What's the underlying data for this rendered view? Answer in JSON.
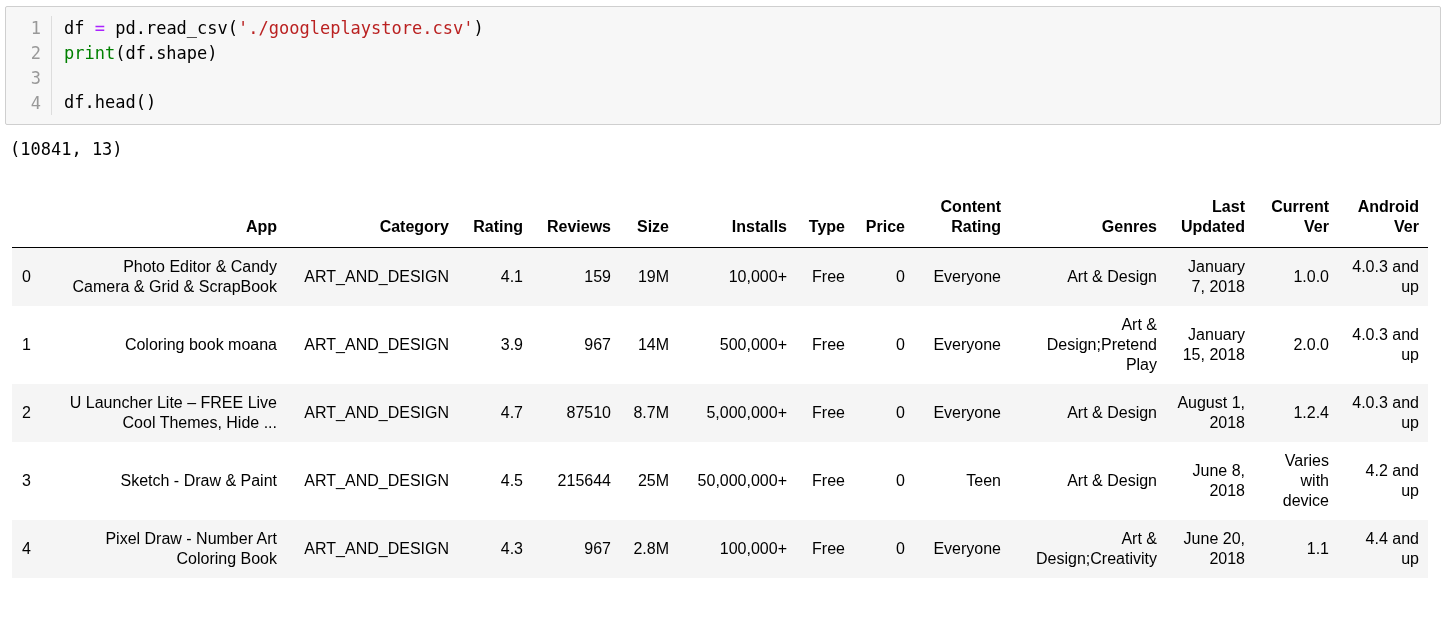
{
  "code_cell": {
    "lines": [
      {
        "number": "1",
        "tokens": [
          {
            "kind": "plain",
            "text": "df "
          },
          {
            "kind": "operator",
            "text": "="
          },
          {
            "kind": "plain",
            "text": " pd.read_csv("
          },
          {
            "kind": "string",
            "text": "'./googleplaystore.csv'"
          },
          {
            "kind": "plain",
            "text": ")"
          }
        ]
      },
      {
        "number": "2",
        "tokens": [
          {
            "kind": "builtin",
            "text": "print"
          },
          {
            "kind": "plain",
            "text": "(df.shape)"
          }
        ]
      },
      {
        "number": "3"
      },
      {
        "number": "4",
        "tokens": [
          {
            "kind": "plain",
            "text": "df.head()"
          }
        ]
      }
    ]
  },
  "stdout": "(10841, 13)",
  "table": {
    "columns": [
      "",
      "App",
      "Category",
      "Rating",
      "Reviews",
      "Size",
      "Installs",
      "Type",
      "Price",
      "Content Rating",
      "Genres",
      "Last Updated",
      "Current Ver",
      "Android Ver"
    ],
    "rows": [
      [
        "0",
        "Photo Editor & Candy Camera & Grid & ScrapBook",
        "ART_AND_DESIGN",
        "4.1",
        "159",
        "19M",
        "10,000+",
        "Free",
        "0",
        "Everyone",
        "Art & Design",
        "January 7, 2018",
        "1.0.0",
        "4.0.3 and up"
      ],
      [
        "1",
        "Coloring book moana",
        "ART_AND_DESIGN",
        "3.9",
        "967",
        "14M",
        "500,000+",
        "Free",
        "0",
        "Everyone",
        "Art & Design;Pretend Play",
        "January 15, 2018",
        "2.0.0",
        "4.0.3 and up"
      ],
      [
        "2",
        "U Launcher Lite – FREE Live Cool Themes, Hide ...",
        "ART_AND_DESIGN",
        "4.7",
        "87510",
        "8.7M",
        "5,000,000+",
        "Free",
        "0",
        "Everyone",
        "Art & Design",
        "August 1, 2018",
        "1.2.4",
        "4.0.3 and up"
      ],
      [
        "3",
        "Sketch - Draw & Paint",
        "ART_AND_DESIGN",
        "4.5",
        "215644",
        "25M",
        "50,000,000+",
        "Free",
        "0",
        "Teen",
        "Art & Design",
        "June 8, 2018",
        "Varies with device",
        "4.2 and up"
      ],
      [
        "4",
        "Pixel Draw - Number Art Coloring Book",
        "ART_AND_DESIGN",
        "4.3",
        "967",
        "2.8M",
        "100,000+",
        "Free",
        "0",
        "Everyone",
        "Art & Design;Creativity",
        "June 20, 2018",
        "1.1",
        "4.4 and up"
      ]
    ]
  }
}
